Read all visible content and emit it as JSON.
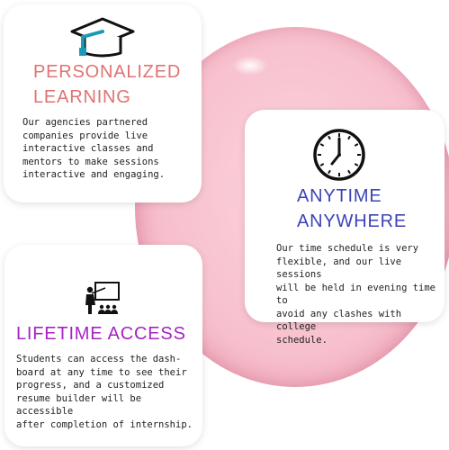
{
  "cards": [
    {
      "title_line1": "PERSONALIZED",
      "title_line2": "LEARNING",
      "lines": [
        "Our agencies partnered",
        "companies provide live",
        "interactive classes and",
        "mentors to make sessions",
        "interactive and engaging."
      ],
      "icon": "graduation-cap-icon"
    },
    {
      "title_line1": "ANYTIME",
      "title_line2": "ANYWHERE",
      "lines": [
        "Our time schedule is very",
        "flexible, and our live sessions",
        "will be held in evening time to",
        "avoid any clashes with college",
        "schedule."
      ],
      "icon": "clock-icon"
    },
    {
      "title_line1": "LIFETIME ACCESS",
      "lines": [
        "Students can access the dash-",
        "board at any time to see their",
        "progress, and a customized",
        "resume builder will be accessible",
        "after completion of internship."
      ],
      "icon": "teacher-presentation-icon"
    }
  ],
  "colors": {
    "personalized": "#e07272",
    "anytime": "#3d43b8",
    "lifetime": "#a623c2",
    "blob": "#f7bfcd"
  }
}
